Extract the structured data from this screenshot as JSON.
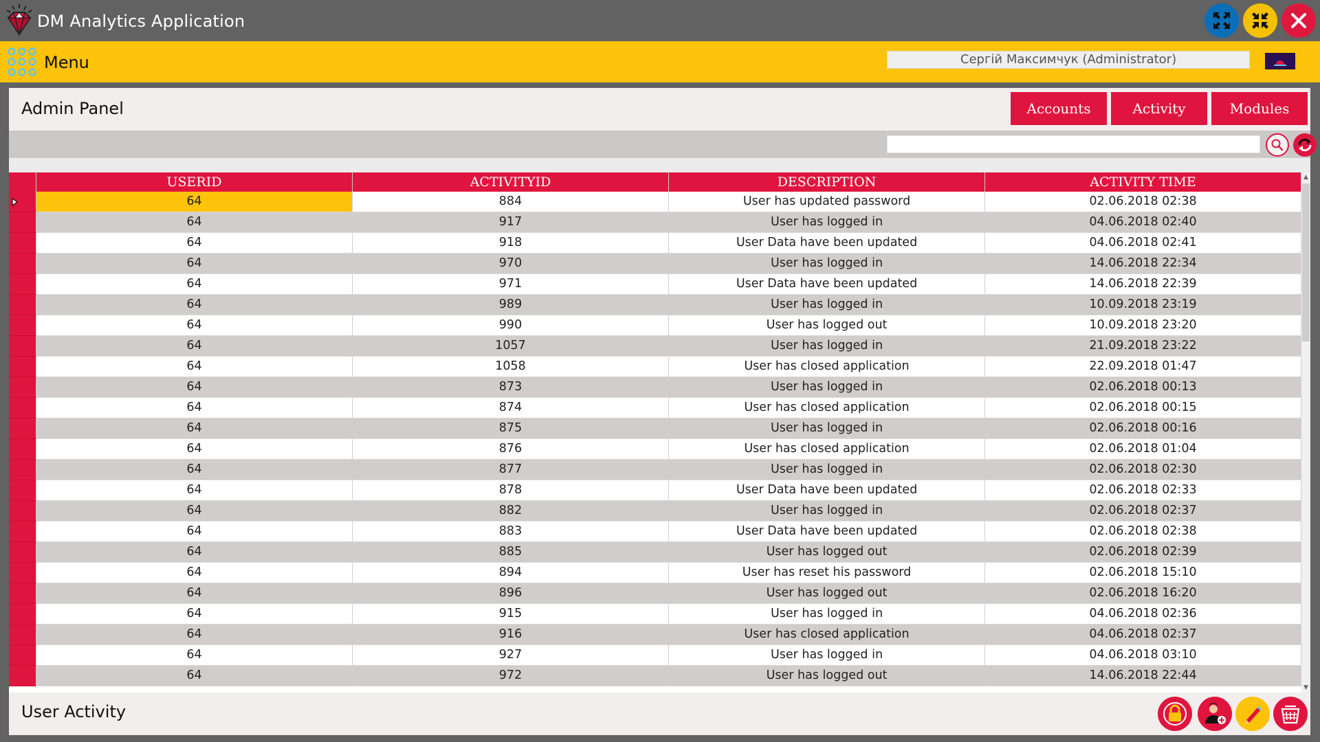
{
  "window": {
    "title": "DM Analytics Application",
    "maximize_icon": "expand-arrows-icon",
    "minimize_icon": "collapse-arrows-icon",
    "close_icon": "close-x-icon"
  },
  "menubar": {
    "label": "Menu",
    "user": "Сергій Максимчук (Administrator)"
  },
  "panel": {
    "title": "Admin Panel",
    "nav": {
      "accounts": "Accounts",
      "activity": "Activity",
      "modules": "Modules"
    },
    "search": {
      "value": "",
      "placeholder": ""
    }
  },
  "grid": {
    "columns": [
      "USERID",
      "ACTIVITYID",
      "DESCRIPTION",
      "ACTIVITY TIME"
    ],
    "rows": [
      [
        "64",
        "884",
        "User has updated password",
        "02.06.2018 02:38"
      ],
      [
        "64",
        "917",
        "User has logged in",
        "04.06.2018 02:40"
      ],
      [
        "64",
        "918",
        "User Data have been updated",
        "04.06.2018 02:41"
      ],
      [
        "64",
        "970",
        "User has logged in",
        "14.06.2018 22:34"
      ],
      [
        "64",
        "971",
        "User Data have been updated",
        "14.06.2018 22:39"
      ],
      [
        "64",
        "989",
        "User has logged in",
        "10.09.2018 23:19"
      ],
      [
        "64",
        "990",
        "User has logged out",
        "10.09.2018 23:20"
      ],
      [
        "64",
        "1057",
        "User has logged in",
        "21.09.2018 23:22"
      ],
      [
        "64",
        "1058",
        "User has closed application",
        "22.09.2018 01:47"
      ],
      [
        "64",
        "873",
        "User has logged in",
        "02.06.2018 00:13"
      ],
      [
        "64",
        "874",
        "User has closed application",
        "02.06.2018 00:15"
      ],
      [
        "64",
        "875",
        "User has logged in",
        "02.06.2018 00:16"
      ],
      [
        "64",
        "876",
        "User has closed application",
        "02.06.2018 01:04"
      ],
      [
        "64",
        "877",
        "User has logged in",
        "02.06.2018 02:30"
      ],
      [
        "64",
        "878",
        "User Data have been updated",
        "02.06.2018 02:33"
      ],
      [
        "64",
        "882",
        "User has logged in",
        "02.06.2018 02:37"
      ],
      [
        "64",
        "883",
        "User Data have been updated",
        "02.06.2018 02:38"
      ],
      [
        "64",
        "885",
        "User has logged out",
        "02.06.2018 02:39"
      ],
      [
        "64",
        "894",
        "User has reset his password",
        "02.06.2018 15:10"
      ],
      [
        "64",
        "896",
        "User has logged out",
        "02.06.2018 16:20"
      ],
      [
        "64",
        "915",
        "User has logged in",
        "04.06.2018 02:36"
      ],
      [
        "64",
        "916",
        "User has closed application",
        "04.06.2018 02:37"
      ],
      [
        "64",
        "927",
        "User has logged in",
        "04.06.2018 03:10"
      ],
      [
        "64",
        "972",
        "User has logged out",
        "14.06.2018 22:44"
      ]
    ],
    "selected_row": 0
  },
  "footer": {
    "title": "User Activity",
    "actions": [
      "lock-icon",
      "add-user-icon",
      "pencil-icon",
      "trash-basket-icon"
    ]
  },
  "colors": {
    "accent_red": "#e0153f",
    "accent_yellow": "#fcc30a",
    "titlebar_gray": "#626262",
    "maximize_blue": "#0b6eb8"
  }
}
